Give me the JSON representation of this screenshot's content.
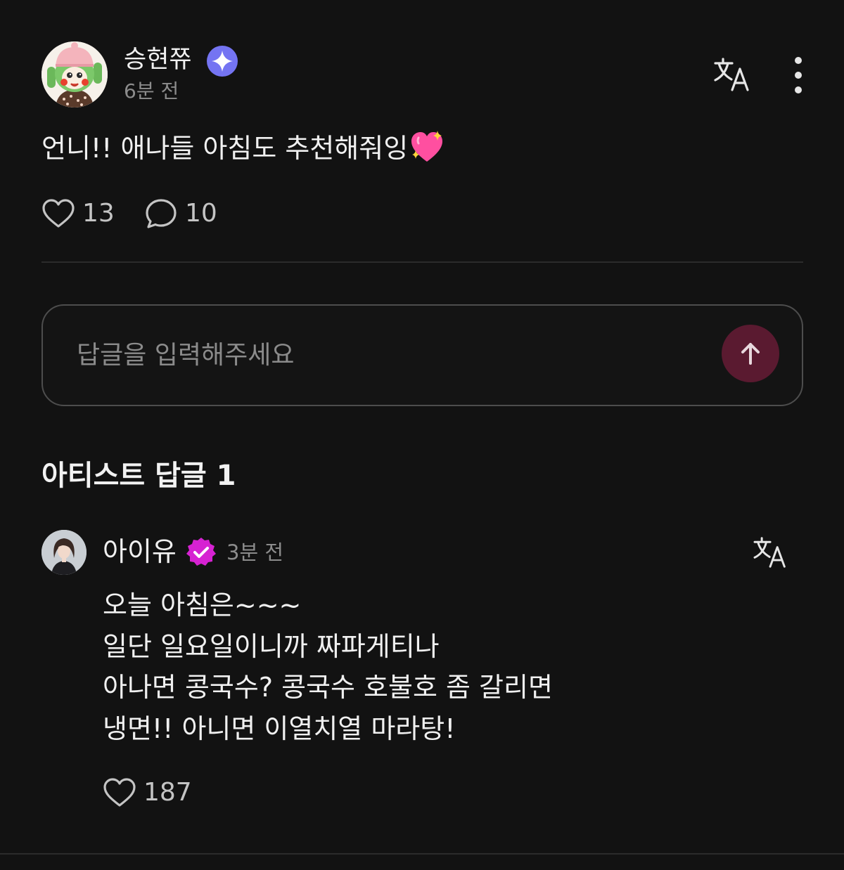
{
  "post": {
    "author_name": "승현쮸",
    "time_ago": "6분 전",
    "content_text": "언니!! 애나들 아침도 추천해줘잉",
    "content_emoji": "sparkling-heart",
    "like_count": "13",
    "comment_count": "10"
  },
  "reply_input": {
    "placeholder": "답글을 입력해주세요"
  },
  "artist_replies": {
    "section_title": "아티스트 답글 1",
    "items": [
      {
        "author_name": "아이유",
        "time_ago": "3분 전",
        "lines": [
          "오늘 아침은~~~",
          "일단 일요일이니까 짜파게티나",
          "아나면 콩국수? 콩국수 호불호 좀 갈리면",
          "냉면!! 아니면 이열치열 마라탕!"
        ],
        "like_count": "187"
      }
    ]
  },
  "icons": {
    "translate": "translate-icon",
    "more": "more-vertical-icon",
    "like": "heart-outline-icon",
    "comment": "comment-bubble-icon",
    "send": "arrow-up-icon",
    "verified_fan": "blue-sparkle-badge-icon",
    "verified_artist": "pink-check-badge-icon"
  },
  "colors": {
    "background": "#121212",
    "text_primary": "#f0f0f0",
    "text_secondary": "#8c8c8c",
    "fan_badge": "#7474f2",
    "artist_badge": "#d622d2",
    "send_button": "#5a1a30"
  }
}
